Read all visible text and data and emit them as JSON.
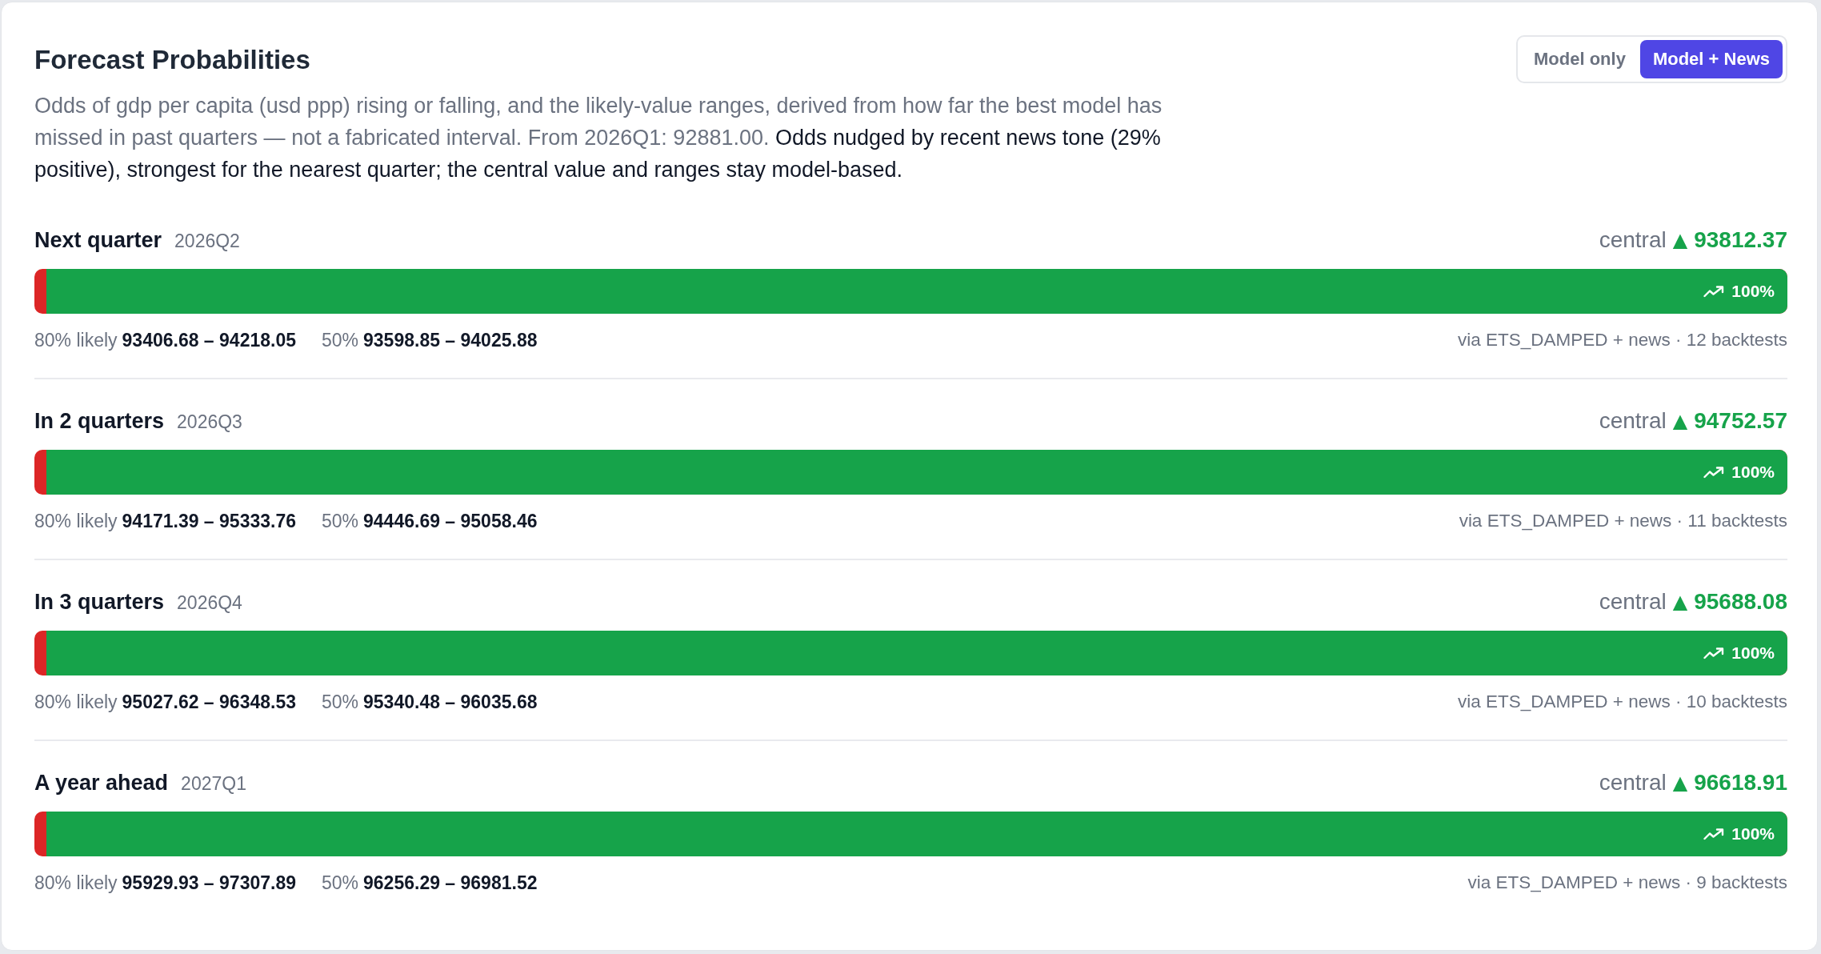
{
  "panel": {
    "title": "Forecast Probabilities",
    "description": "Odds of gdp per capita (usd ppp) rising or falling, and the likely-value ranges, derived from how far the best model has missed in past quarters — not a fabricated interval. From 2026Q1: 92881.00.",
    "news_note": "Odds nudged by recent news tone (29% positive), strongest for the nearest quarter; the central value and ranges stay model-based."
  },
  "mode_toggle": [
    {
      "label": "Model only",
      "selected": false
    },
    {
      "label": "Model + News",
      "selected": true
    }
  ],
  "horizons": [
    {
      "label": "Next quarter",
      "quarter": "2026Q2",
      "central_label": "central",
      "arrow": "▲",
      "central": "93812.37",
      "level": 0.993,
      "percent": "100%",
      "range_80_label": "80% likely",
      "range_80": "93406.68 – 94218.05",
      "range_50_label": "50%",
      "range_50": "93598.85 – 94025.88",
      "source": "via ETS_DAMPED + news · 12 backtests"
    },
    {
      "label": "In 2 quarters",
      "quarter": "2026Q3",
      "central_label": "central",
      "arrow": "▲",
      "central": "94752.57",
      "level": 0.993,
      "percent": "100%",
      "range_80_label": "80% likely",
      "range_80": "94171.39 – 95333.76",
      "range_50_label": "50%",
      "range_50": "94446.69 – 95058.46",
      "source": "via ETS_DAMPED + news · 11 backtests"
    },
    {
      "label": "In 3 quarters",
      "quarter": "2026Q4",
      "central_label": "central",
      "arrow": "▲",
      "central": "95688.08",
      "level": 0.993,
      "percent": "100%",
      "range_80_label": "80% likely",
      "range_80": "95027.62 – 96348.53",
      "range_50_label": "50%",
      "range_50": "95340.48 – 96035.68",
      "source": "via ETS_DAMPED + news · 10 backtests"
    },
    {
      "label": "A year ahead",
      "quarter": "2027Q1",
      "central_label": "central",
      "arrow": "▲",
      "central": "96618.91",
      "level": 0.993,
      "percent": "100%",
      "range_80_label": "80% likely",
      "range_80": "95929.93 – 97307.89",
      "range_50_label": "50%",
      "range_50": "96256.29 – 96981.52",
      "source": "via ETS_DAMPED + news · 9 backtests"
    }
  ]
}
